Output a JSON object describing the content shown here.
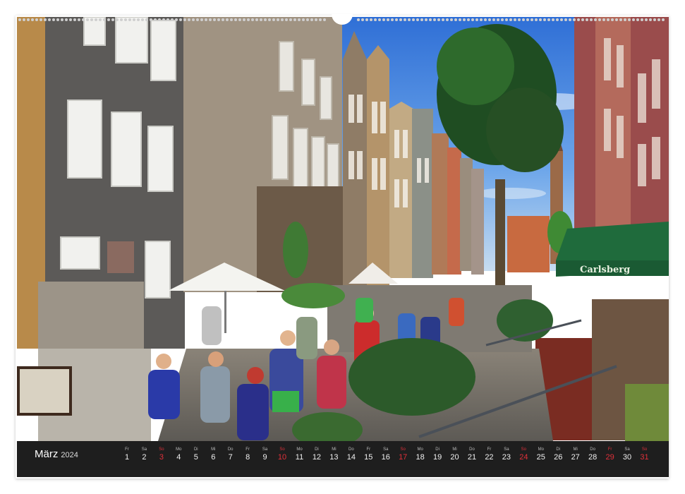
{
  "calendar": {
    "month": "März",
    "year": "2024",
    "weekend_color": "#e0303a",
    "days": [
      {
        "wd": "Fr",
        "n": "1",
        "we": false
      },
      {
        "wd": "Sa",
        "n": "2",
        "we": false
      },
      {
        "wd": "So",
        "n": "3",
        "we": true
      },
      {
        "wd": "Mo",
        "n": "4",
        "we": false
      },
      {
        "wd": "Di",
        "n": "5",
        "we": false
      },
      {
        "wd": "Mi",
        "n": "6",
        "we": false
      },
      {
        "wd": "Do",
        "n": "7",
        "we": false
      },
      {
        "wd": "Fr",
        "n": "8",
        "we": false
      },
      {
        "wd": "Sa",
        "n": "9",
        "we": false
      },
      {
        "wd": "So",
        "n": "10",
        "we": true
      },
      {
        "wd": "Mo",
        "n": "11",
        "we": false
      },
      {
        "wd": "Di",
        "n": "12",
        "we": false
      },
      {
        "wd": "Mi",
        "n": "13",
        "we": false
      },
      {
        "wd": "Do",
        "n": "14",
        "we": false
      },
      {
        "wd": "Fr",
        "n": "15",
        "we": false
      },
      {
        "wd": "Sa",
        "n": "16",
        "we": false
      },
      {
        "wd": "So",
        "n": "17",
        "we": true
      },
      {
        "wd": "Mo",
        "n": "18",
        "we": false
      },
      {
        "wd": "Di",
        "n": "19",
        "we": false
      },
      {
        "wd": "Mi",
        "n": "20",
        "we": false
      },
      {
        "wd": "Do",
        "n": "21",
        "we": false
      },
      {
        "wd": "Fr",
        "n": "22",
        "we": false
      },
      {
        "wd": "Sa",
        "n": "23",
        "we": false
      },
      {
        "wd": "So",
        "n": "24",
        "we": true
      },
      {
        "wd": "Mo",
        "n": "25",
        "we": false
      },
      {
        "wd": "Di",
        "n": "26",
        "we": false
      },
      {
        "wd": "Mi",
        "n": "27",
        "we": false
      },
      {
        "wd": "Do",
        "n": "28",
        "we": false
      },
      {
        "wd": "Fr",
        "n": "29",
        "we": true
      },
      {
        "wd": "Sa",
        "n": "30",
        "we": false
      },
      {
        "wd": "So",
        "n": "31",
        "we": true
      }
    ]
  },
  "photo": {
    "sign_text": "Carlsberg"
  }
}
